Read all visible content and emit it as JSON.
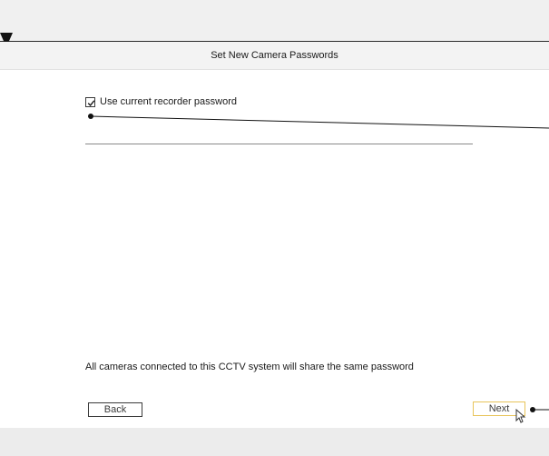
{
  "dialog": {
    "title": "Set New Camera Passwords",
    "use_current_password": {
      "label": "Use current recorder password",
      "checked": true
    },
    "info_text": "All cameras connected to this CCTV system will share the same password",
    "back_label": "Back",
    "next_label": "Next"
  },
  "icons": {
    "checkbox_mark": "checkmark-icon",
    "pointer": "mouse-pointer-icon",
    "marker": "triangle-marker-icon"
  },
  "colors": {
    "accent_border": "#e8c45a",
    "callout_line": "#111111"
  }
}
